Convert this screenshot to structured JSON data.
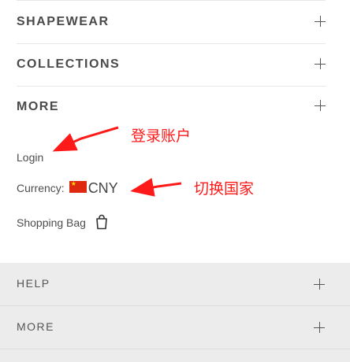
{
  "menu": {
    "sections": [
      {
        "label": "SHAPEWEAR"
      },
      {
        "label": "COLLECTIONS"
      },
      {
        "label": "MORE"
      }
    ]
  },
  "links": {
    "login": "Login",
    "currency_label": "Currency:",
    "currency_code": "CNY",
    "currency_flag": "china-flag-icon",
    "shopping_bag": "Shopping Bag",
    "shopping_bag_icon": "shopping-bag-icon"
  },
  "annotations": {
    "login_note": "登录账户",
    "currency_note": "切换国家",
    "color": "#ff1a1a"
  },
  "footer": {
    "sections": [
      {
        "label": "HELP"
      },
      {
        "label": "MORE"
      }
    ]
  }
}
